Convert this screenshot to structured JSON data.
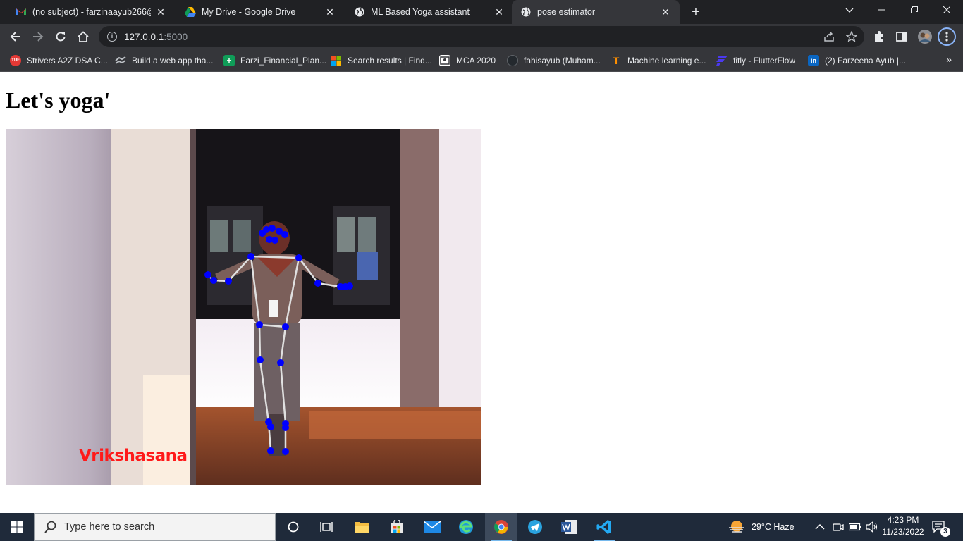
{
  "browser": {
    "tabs": [
      {
        "title": "(no subject) - farzinaayub266@g",
        "icon": "gmail-icon",
        "active": false
      },
      {
        "title": "My Drive - Google Drive",
        "icon": "google-drive-icon",
        "active": false
      },
      {
        "title": "ML Based Yoga assistant",
        "icon": "globe-icon",
        "active": false
      },
      {
        "title": "pose estimator",
        "icon": "globe-icon",
        "active": true
      }
    ],
    "close_glyph": "✕",
    "new_tab_glyph": "+",
    "address": {
      "host": "127.0.0.1",
      "port": ":5000"
    },
    "bookmarks": [
      {
        "label": "Strivers A2Z DSA C...",
        "icon": "tuf-icon",
        "color": "#e53935",
        "icon_text": "TUF"
      },
      {
        "label": "Build a web app tha...",
        "icon": "link-icon",
        "color": "#9aa0a6",
        "icon_text": ""
      },
      {
        "label": "Farzi_Financial_Plan...",
        "icon": "sheets-icon",
        "color": "#0f9d58",
        "icon_text": "+"
      },
      {
        "label": "Search results | Find...",
        "icon": "microsoft-icon",
        "color": "#f25022",
        "icon_text": ""
      },
      {
        "label": "MCA 2020",
        "icon": "classroom-icon",
        "color": "#ffffff",
        "icon_text": ""
      },
      {
        "label": "fahisayub (Muham...",
        "icon": "github-icon",
        "color": "#24292e",
        "icon_text": ""
      },
      {
        "label": "Machine learning e...",
        "icon": "tensorflow-icon",
        "color": "#ff8f00",
        "icon_text": "T"
      },
      {
        "label": "fitly - FlutterFlow",
        "icon": "flutterflow-icon",
        "color": "#4b39ef",
        "icon_text": ""
      },
      {
        "label": "(2) Farzeena Ayub |...",
        "icon": "linkedin-icon",
        "color": "#0a66c2",
        "icon_text": "in"
      }
    ],
    "more_bookmarks_glyph": "»"
  },
  "page": {
    "heading": "Let's yoga'",
    "pose_label": "Vrikshasana"
  },
  "taskbar": {
    "search_placeholder": "Type here to search",
    "weather": "29°C  Haze",
    "time": "4:23 PM",
    "date": "11/23/2022",
    "notification_count": "3"
  }
}
